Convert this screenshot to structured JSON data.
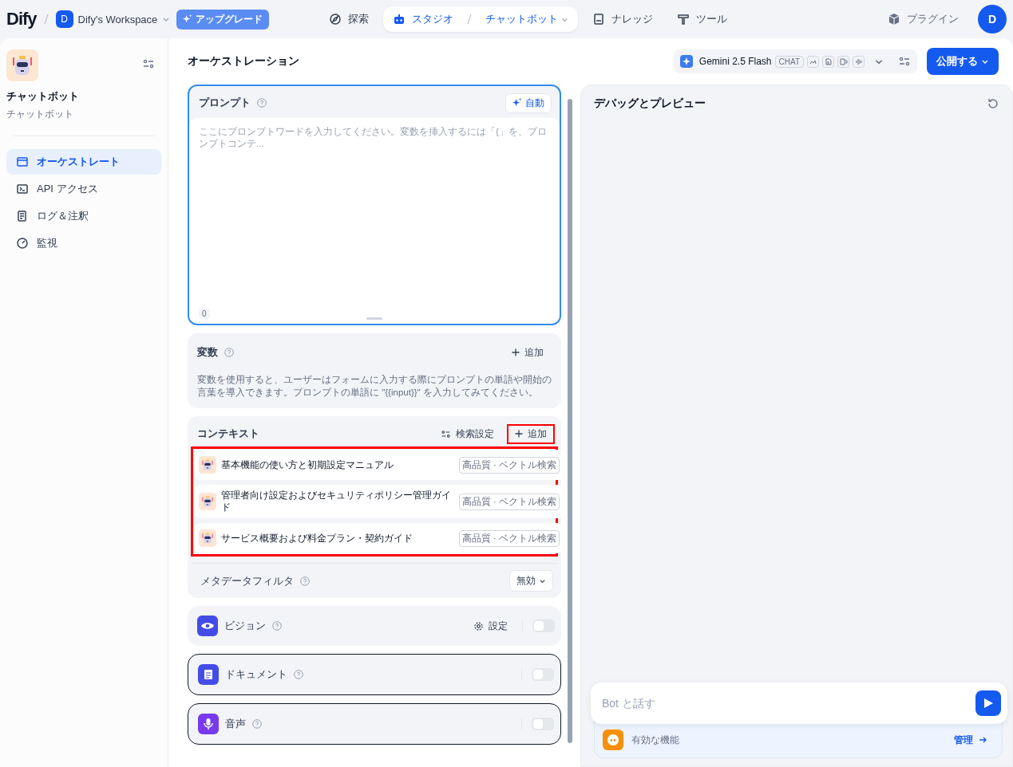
{
  "topbar": {
    "logo": "Dify",
    "workspace_initial": "D",
    "workspace_name": "Dify's Workspace",
    "upgrade": "アップグレード",
    "nav": [
      {
        "label": "探索",
        "selected": false
      },
      {
        "label": "スタジオ",
        "selected": true,
        "sub": "チャットボット"
      },
      {
        "label": "ナレッジ",
        "selected": false
      },
      {
        "label": "ツール",
        "selected": false
      }
    ],
    "plugin": "プラグイン",
    "avatar": "D"
  },
  "sidebar": {
    "app_name": "チャットボット",
    "app_type": "チャットボット",
    "items": [
      {
        "label": "オーケストレート",
        "selected": true
      },
      {
        "label": "API アクセス",
        "selected": false
      },
      {
        "label": "ログ＆注釈",
        "selected": false
      },
      {
        "label": "監視",
        "selected": false
      }
    ]
  },
  "orchestration": {
    "title": "オーケストレーション",
    "model": "Gemini 2.5 Flash",
    "model_mode": "CHAT",
    "publish": "公開する",
    "prompt": {
      "title": "プロンプト",
      "auto": "自動",
      "placeholder": "ここにプロンプトワードを入力してください。変数を挿入するには「{」を、プロンプトコンテ...",
      "count": "0"
    },
    "variables": {
      "title": "変数",
      "add": "追加",
      "description": "変数を使用すると、ユーザーはフォームに入力する際にプロンプトの単語や開始の言葉を導入できます。プロンプトの単語に \"{{input}}\" を入力してみてください。"
    },
    "context": {
      "title": "コンテキスト",
      "retrieval_settings": "検索設定",
      "add": "追加",
      "add_highlighted": true,
      "datasets_highlighted": true,
      "datasets": [
        {
          "name": "基本機能の使い方と初期設定マニュアル",
          "tag": "高品質 · ベクトル検索"
        },
        {
          "name": "管理者向け設定およびセキュリティポリシー管理ガイド",
          "tag": "高品質 · ベクトル検索"
        },
        {
          "name": "サービス概要および料金プラン・契約ガイド",
          "tag": "高品質 · ベクトル検索"
        }
      ],
      "metadata_filter": "メタデータフィルタ",
      "metadata_value": "無効"
    },
    "features": [
      {
        "kind": "vision",
        "label": "ビジョン",
        "settings": "設定",
        "on": false
      },
      {
        "kind": "document",
        "label": "ドキュメント",
        "on": false
      },
      {
        "kind": "audio",
        "label": "音声",
        "on": false
      }
    ]
  },
  "debug": {
    "title": "デバッグとプレビュー",
    "input_placeholder": "Bot と話す",
    "features_label": "有効な機能",
    "manage": "管理"
  }
}
